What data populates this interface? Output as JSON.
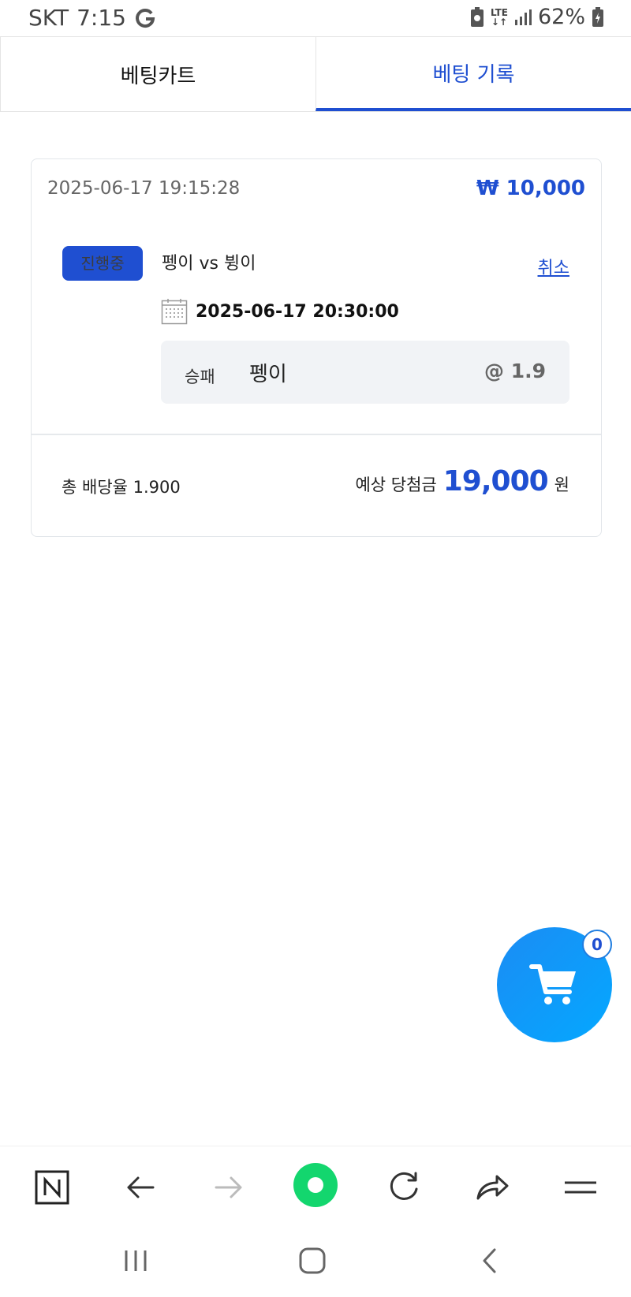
{
  "status_bar": {
    "carrier": "SKT",
    "time": "7:15",
    "network": "LTE",
    "battery": "62%"
  },
  "tabs": [
    {
      "label": "베팅카트",
      "active": false
    },
    {
      "label": "베팅 기록",
      "active": true
    }
  ],
  "bet": {
    "datetime": "2025-06-17 19:15:28",
    "amount": "₩ 10,000",
    "status": "진행중",
    "match": "펭이 vs 뷩이",
    "cancel_label": "취소",
    "match_time": "2025-06-17 20:30:00",
    "market": "승패",
    "pick": "펭이",
    "odds": "@ 1.9",
    "total_odds_label": "총 배당율 1.900",
    "expected_label": "예상 당첨금",
    "expected_amount": "19,000",
    "expected_unit": "원"
  },
  "cart": {
    "count": "0"
  },
  "colors": {
    "accent": "#1f4fd1",
    "fab": "#0aa0ff",
    "browser_home": "#13d66e"
  },
  "browser_toolbar": [
    "naver-n-icon",
    "back-arrow-icon",
    "forward-arrow-icon",
    "home-circle-icon",
    "refresh-icon",
    "share-icon",
    "menu-icon"
  ],
  "system_nav": [
    "recent-apps-icon",
    "home-icon",
    "back-icon"
  ]
}
